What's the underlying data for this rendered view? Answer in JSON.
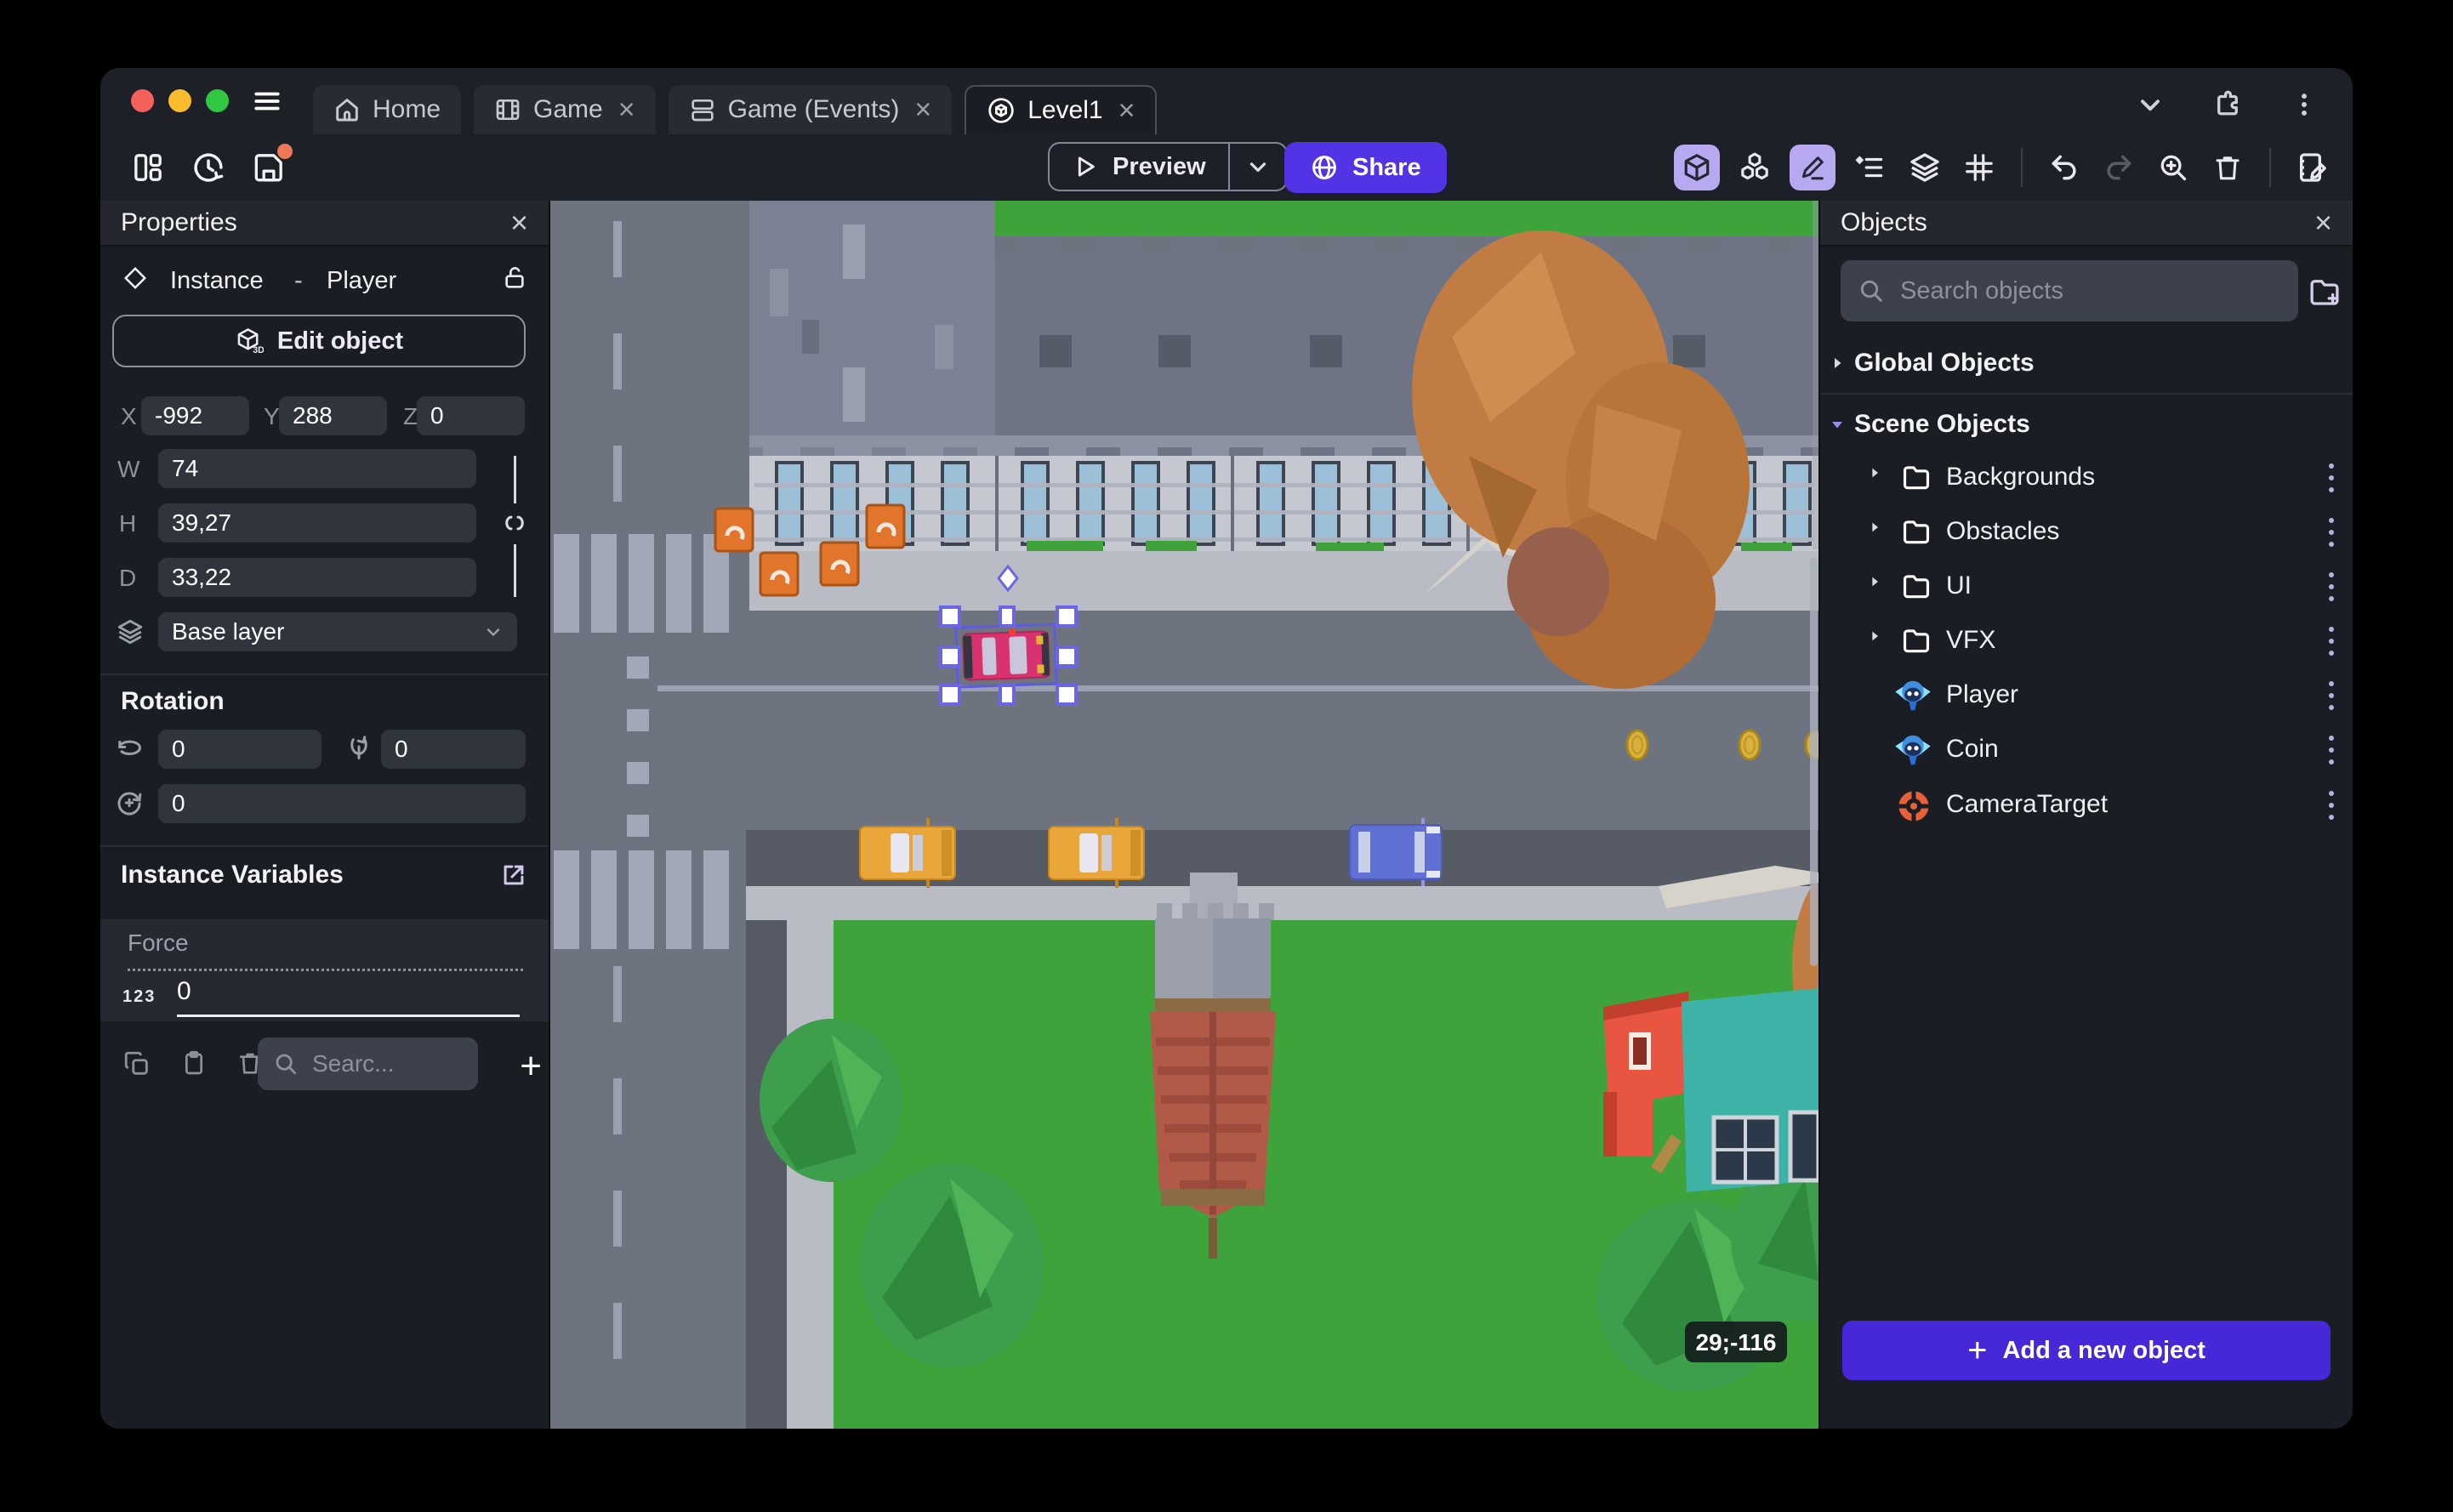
{
  "window": {
    "tabs": [
      {
        "label": "Home",
        "icon": "home-icon",
        "active": false,
        "closable": false
      },
      {
        "label": "Game",
        "icon": "film-icon",
        "active": false,
        "closable": true
      },
      {
        "label": "Game (Events)",
        "icon": "events-sheet-icon",
        "active": false,
        "closable": true
      },
      {
        "label": "Level1",
        "icon": "scene-icon",
        "active": true,
        "closable": true
      }
    ],
    "controls_icons": [
      "chevron-down-icon",
      "extensions-icon",
      "kebab-menu-icon"
    ]
  },
  "glyphs": {
    "close": "×",
    "plus": "+"
  },
  "toolbar": {
    "left_icons": [
      "panels-icon",
      "history-icon",
      "save-icon"
    ],
    "save_has_unsaved_dot": true,
    "preview_label": "Preview",
    "share_label": "Share",
    "right_icons": [
      "view-3d-icon",
      "objects-icon",
      "edit-icon",
      "instances-list-icon",
      "layers-icon",
      "grid-icon",
      "undo-icon",
      "redo-icon",
      "zoom-in-icon",
      "trash-icon",
      "scene-properties-icon"
    ],
    "active_right_icons": [
      "view-3d-icon",
      "edit-icon"
    ]
  },
  "properties": {
    "title": "Properties",
    "header": {
      "kind": "Instance",
      "separator": "-",
      "object": "Player"
    },
    "edit_object_label": "Edit object",
    "position": {
      "x_label": "X",
      "x_value": "-992",
      "y_label": "Y",
      "y_value": "288",
      "z_label": "Z",
      "z_value": "0"
    },
    "size": {
      "w_label": "W",
      "w_value": "74",
      "h_label": "H",
      "h_value": "39,27",
      "d_label": "D",
      "d_value": "33,22"
    },
    "layer_value": "Base layer",
    "rotation_title": "Rotation",
    "rotation": {
      "x_value": "0",
      "y_value": "0",
      "z_value": "0"
    },
    "instance_variables_title": "Instance Variables",
    "variables": [
      {
        "name": "Force",
        "type_badge": "123",
        "value": "0"
      }
    ],
    "variables_search_placeholder": "Searc..."
  },
  "objects_panel": {
    "title": "Objects",
    "search_placeholder": "Search objects",
    "global_group_label": "Global Objects",
    "scene_group_label": "Scene Objects",
    "folders": [
      {
        "name": "Backgrounds"
      },
      {
        "name": "Obstacles"
      },
      {
        "name": "UI"
      },
      {
        "name": "VFX"
      }
    ],
    "objects": [
      {
        "name": "Player",
        "icon": "sprite-3d-icon"
      },
      {
        "name": "Coin",
        "icon": "sprite-3d-icon"
      },
      {
        "name": "CameraTarget",
        "icon": "camera-target-icon"
      }
    ],
    "add_button_label": "Add a new object"
  },
  "scene_view": {
    "cursor_coordinates": "29;-116"
  },
  "colors": {
    "accent_purple": "#5233e6",
    "add_button": "#4628d8",
    "active_tool_bg": "#b7a8f2",
    "selection": "#5e5ae2",
    "unsaved_dot": "#ed7757",
    "traffic_red": "#f5605a",
    "traffic_yellow": "#fbbb2f",
    "traffic_green": "#2fc840",
    "road": "#6e7380",
    "grass": "#3fa33c",
    "sidewalk": "#b9bcc4"
  }
}
